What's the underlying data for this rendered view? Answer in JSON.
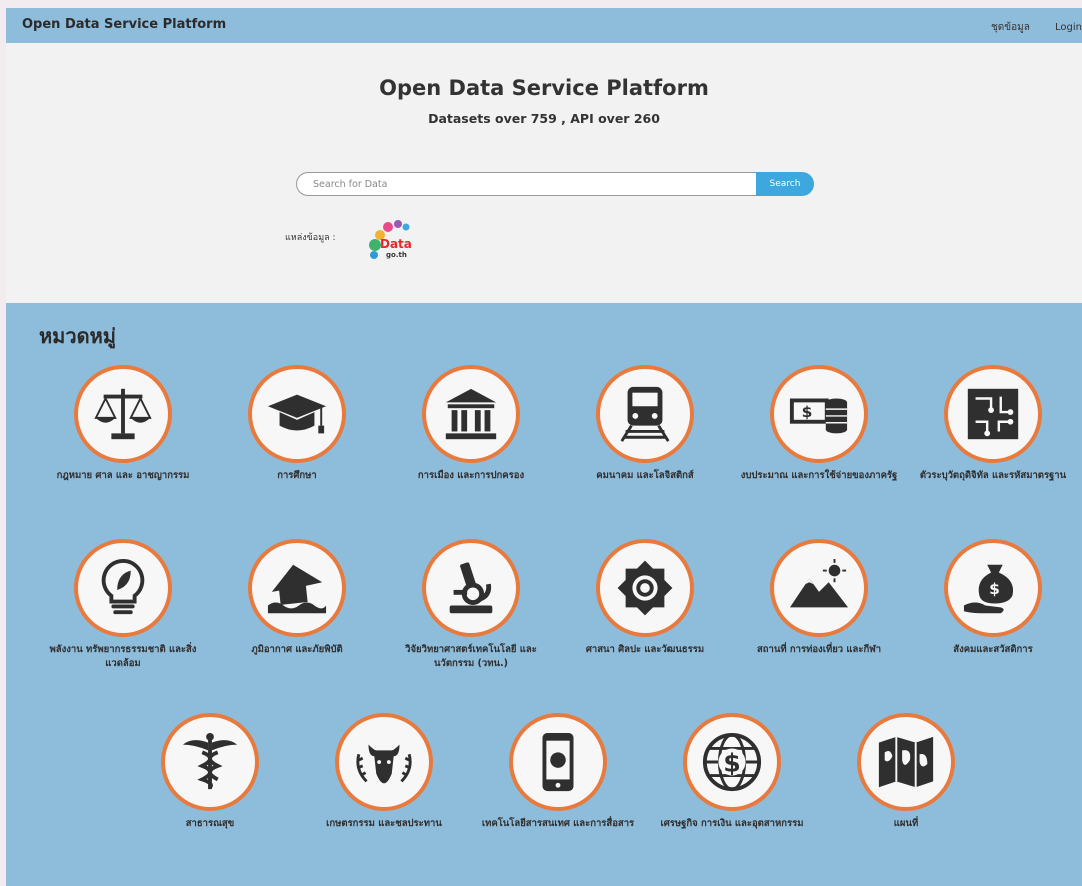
{
  "navbar": {
    "brand": "Open Data Service Platform",
    "links": [
      "ชุดข้อมูล",
      "Login"
    ]
  },
  "hero": {
    "title": "Open Data Service Platform",
    "subtitle": "Datasets over 759 , API over 260",
    "search_placeholder": "Search for Data",
    "search_button": "Search",
    "source_label": "แหล่งข้อมูล :",
    "source_logo_text": "Data",
    "source_logo_subtext": "go.th"
  },
  "categories_heading": "หมวดหมู่",
  "categories": [
    {
      "label": "กฎหมาย ศาล และ อาชญากรรม",
      "icon": "scales-icon"
    },
    {
      "label": "การศึกษา",
      "icon": "graduation-cap-icon"
    },
    {
      "label": "การเมือง และการปกครอง",
      "icon": "government-building-icon"
    },
    {
      "label": "คมนาคม และโลจิสติกส์",
      "icon": "train-icon"
    },
    {
      "label": "งบประมาณ และการใช้จ่ายของภาครัฐ",
      "icon": "money-coins-icon"
    },
    {
      "label": "ตัวระบุวัตถุดิจิทัล และรหัสมาตรฐาน",
      "icon": "circuit-icon"
    },
    {
      "label": "พลังงาน ทรัพยากรธรรมชาติ และสิ่งแวดล้อม",
      "icon": "eco-bulb-icon"
    },
    {
      "label": "ภูมิอากาศ และภัยพิบัติ",
      "icon": "flood-house-icon"
    },
    {
      "label": "วิจัยวิทยาศาสตร์เทคโนโลยี และนวัตกรรม (วทน.)",
      "icon": "microscope-icon"
    },
    {
      "label": "ศาสนา ศิลปะ และวัฒนธรรม",
      "icon": "ornament-icon"
    },
    {
      "label": "สถานที่ การท่องเที่ยว และกีฬา",
      "icon": "mountains-icon"
    },
    {
      "label": "สังคมและสวัสดิการ",
      "icon": "money-bag-hand-icon"
    },
    {
      "label": "สาธารณสุข",
      "icon": "caduceus-icon"
    },
    {
      "label": "เกษตรกรรม และชลประทาน",
      "icon": "cow-wreath-icon"
    },
    {
      "label": "เทคโนโลยีสารสนเทศ และการสื่อสาร",
      "icon": "smartphone-globe-icon"
    },
    {
      "label": "เศรษฐกิจ การเงิน และอุตสาหกรรม",
      "icon": "globe-dollar-icon"
    },
    {
      "label": "แผนที่",
      "icon": "map-icon"
    }
  ],
  "colors": {
    "navbar": "#8ebcdb",
    "accent": "#3ea7dd",
    "circle_border": "#e87a3d"
  }
}
